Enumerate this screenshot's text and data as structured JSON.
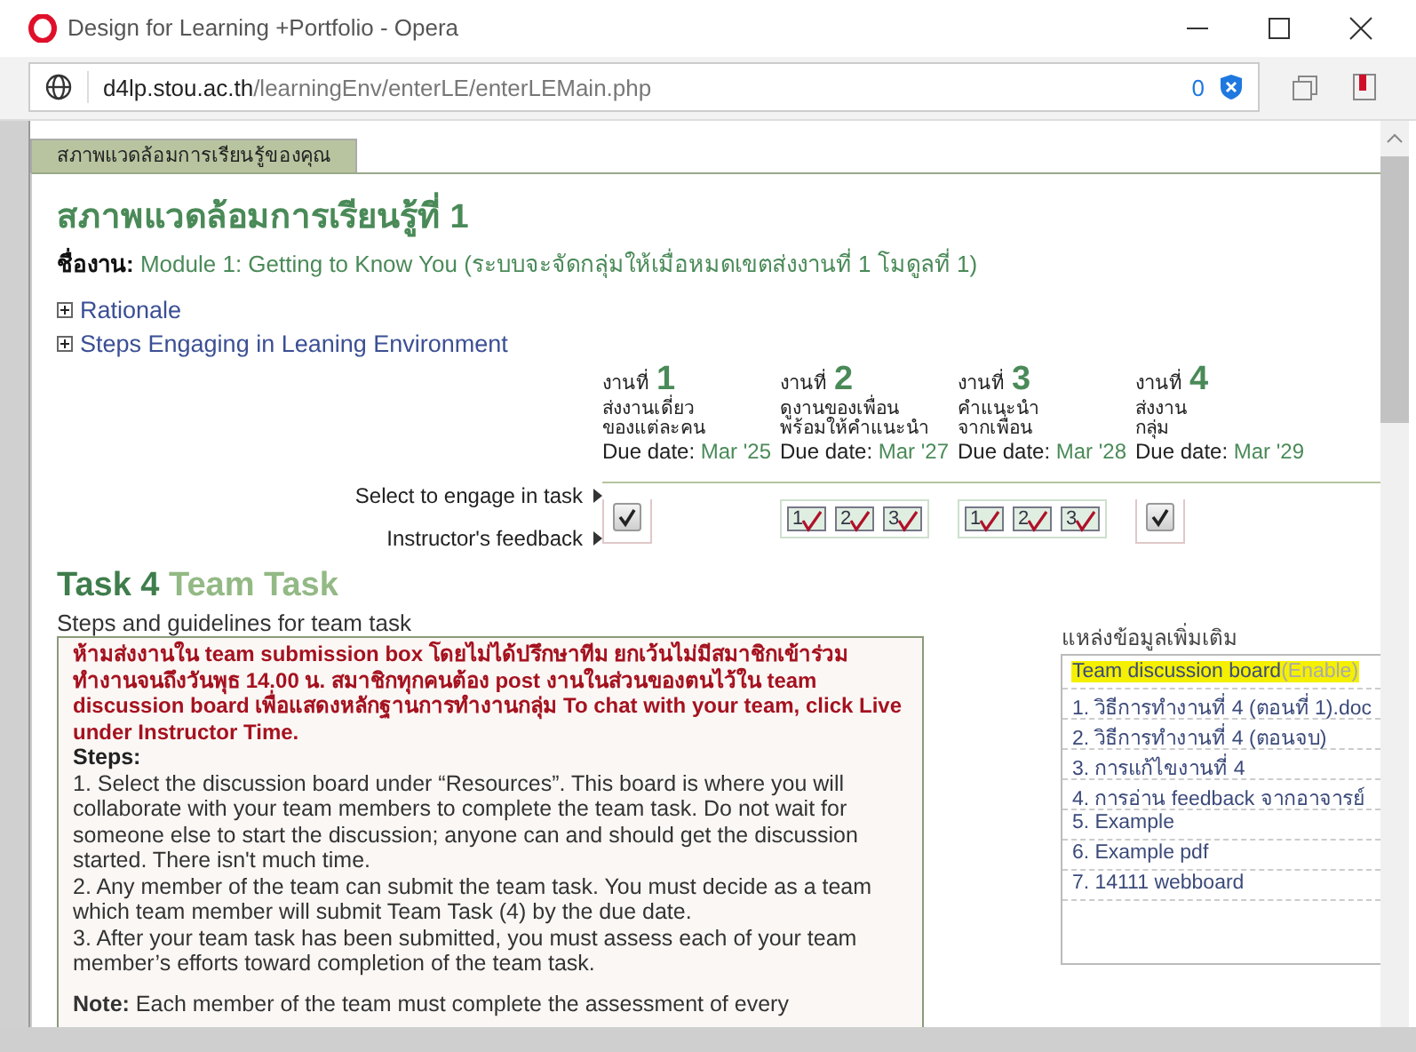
{
  "window": {
    "title": "Design for Learning +Portfolio - Opera"
  },
  "address_bar": {
    "host": "d4lp.stou.ac.th",
    "path": "/learningEnv/enterLE/enterLEMain.php",
    "blocked_count": "0"
  },
  "page_tab": {
    "label": "สภาพแวดล้อมการเรียนรู้ของคุณ",
    "selected": true
  },
  "heading": "สภาพแวดล้อมการเรียนรู้ที่ 1",
  "assignment": {
    "label": "ชื่องาน:",
    "value": "Module 1: Getting to Know You (ระบบจะจัดกลุ่มให้เมื่อหมดเขตส่งงานที่ 1 โมดูลที่ 1)"
  },
  "sections": [
    {
      "label": "Rationale",
      "expanded": false
    },
    {
      "label": "Steps Engaging in Leaning Environment",
      "expanded": false
    }
  ],
  "tasks": [
    {
      "prefix": "งานที่",
      "number": "1",
      "description": [
        "ส่งงานเดี่ยว",
        "ของแต่ละคน"
      ],
      "due_label": "Due date:",
      "due": "Mar '25",
      "checkboxes": [
        {
          "checked": true
        }
      ]
    },
    {
      "prefix": "งานที่",
      "number": "2",
      "description": [
        "ดูงานของเพื่อน",
        "พร้อมให้คำแนะนำ"
      ],
      "due_label": "Due date:",
      "due": "Mar '27",
      "checkboxes": [
        {
          "label": "1",
          "checked": true
        },
        {
          "label": "2",
          "checked": true
        },
        {
          "label": "3",
          "checked": true
        }
      ]
    },
    {
      "prefix": "งานที่",
      "number": "3",
      "description": [
        "คำแนะนำ",
        "จากเพื่อน"
      ],
      "due_label": "Due date:",
      "due": "Mar '28",
      "checkboxes": [
        {
          "label": "1",
          "checked": true
        },
        {
          "label": "2",
          "checked": true
        },
        {
          "label": "3",
          "checked": true
        }
      ]
    },
    {
      "prefix": "งานที่",
      "number": "4",
      "description": [
        "ส่งงาน",
        "กลุ่ม"
      ],
      "due_label": "Due date:",
      "due": "Mar '29",
      "checkboxes": [
        {
          "checked": true
        }
      ]
    }
  ],
  "row_labels": [
    "Select to engage in task",
    "Instructor's feedback"
  ],
  "task_title": {
    "number_part": "Task 4",
    "name_part": "Team Task"
  },
  "guidelines_title": "Steps and guidelines for team task",
  "warning": "ห้ามส่งงานใน team submission box โดยไม่ได้ปรึกษาทีม ยกเว้นไม่มีสมาชิกเข้าร่วมทำงานจนถึงวันพุธ 14.00 น. สมาชิกทุกคนต้อง post งานในส่วนของตนไว้ใน team discussion board เพื่อแสดงหลักฐานการทำงานกลุ่ม To chat with your team, click Live under Instructor Time.",
  "steps_label": "Steps:",
  "steps": [
    "1. Select the discussion board under “Resources”. This board is where you will collaborate with your team members to complete the team task. Do not wait for someone else to start the discussion; anyone can and should get the discussion started. There isn't much time.",
    "2. Any member of the team can submit the team task. You must decide as a team which team member will submit Team Task (4) by the due date.",
    "3. After your team task has been submitted, you must assess each of your team member’s efforts toward completion of the team task."
  ],
  "note": "**Note:** Each member of the team must complete the assessment of every",
  "resources": {
    "title": "แหล่งข้อมูลเพิ่มเติม",
    "items": [
      {
        "label": "Team discussion board",
        "status": "(Enable)",
        "highlighted": true
      },
      {
        "label": "1. วิธีการทำงานที่ 4 (ตอนที่ 1).doc",
        "highlighted": false
      },
      {
        "label": "2. วิธีการทำงานที่ 4 (ตอนจบ)",
        "highlighted": false
      },
      {
        "label": "3. การแก้ไขงานที่ 4",
        "highlighted": false
      },
      {
        "label": "4. การอ่าน feedback จากอาจารย์",
        "highlighted": false
      },
      {
        "label": "5. Example",
        "highlighted": false
      },
      {
        "label": "6. Example pdf",
        "highlighted": false
      },
      {
        "label": "7. 14111 webboard",
        "highlighted": false
      }
    ]
  }
}
